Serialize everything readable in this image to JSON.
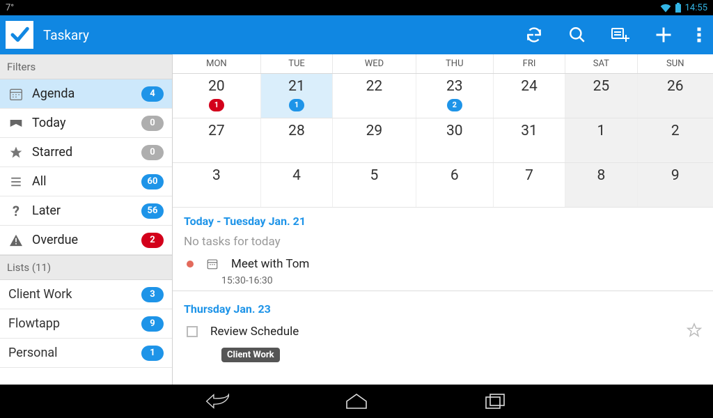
{
  "status": {
    "temp": "7°",
    "time": "14:55"
  },
  "app": {
    "title": "Taskary"
  },
  "sidebar": {
    "filters_header": "Filters",
    "lists_header": "Lists (11)",
    "filters": [
      {
        "label": "Agenda",
        "count": "4",
        "color": "blue",
        "selected": true
      },
      {
        "label": "Today",
        "count": "0",
        "color": "gray"
      },
      {
        "label": "Starred",
        "count": "0",
        "color": "gray"
      },
      {
        "label": "All",
        "count": "60",
        "color": "blue"
      },
      {
        "label": "Later",
        "count": "56",
        "color": "blue"
      },
      {
        "label": "Overdue",
        "count": "2",
        "color": "red"
      }
    ],
    "lists": [
      {
        "label": "Client Work",
        "count": "3"
      },
      {
        "label": "Flowtapp",
        "count": "9"
      },
      {
        "label": "Personal",
        "count": "1"
      }
    ]
  },
  "calendar": {
    "days": [
      "MON",
      "TUE",
      "WED",
      "THU",
      "FRI",
      "SAT",
      "SUN"
    ],
    "rows": [
      [
        {
          "n": "20",
          "badge": "1",
          "badge_color": "red"
        },
        {
          "n": "21",
          "badge": "1",
          "badge_color": "blue",
          "today": true
        },
        {
          "n": "22"
        },
        {
          "n": "23",
          "badge": "2",
          "badge_color": "blue"
        },
        {
          "n": "24"
        },
        {
          "n": "25",
          "weekend": true
        },
        {
          "n": "26",
          "weekend": true
        }
      ],
      [
        {
          "n": "27"
        },
        {
          "n": "28"
        },
        {
          "n": "29"
        },
        {
          "n": "30"
        },
        {
          "n": "31"
        },
        {
          "n": "1",
          "weekend": true
        },
        {
          "n": "2",
          "weekend": true
        }
      ],
      [
        {
          "n": "3"
        },
        {
          "n": "4"
        },
        {
          "n": "5"
        },
        {
          "n": "6"
        },
        {
          "n": "7"
        },
        {
          "n": "8",
          "weekend": true
        },
        {
          "n": "9",
          "weekend": true
        }
      ]
    ]
  },
  "agenda": {
    "sections": [
      {
        "header": "Today - Tuesday Jan. 21",
        "empty_text": "No tasks for today",
        "tasks": [
          {
            "title": "Meet with Tom",
            "time": "15:30-16:30",
            "dot": true
          }
        ]
      },
      {
        "header": "Thursday Jan. 23",
        "tasks": [
          {
            "title": "Review Schedule",
            "tag": "Client Work",
            "checkbox": true,
            "star": true
          }
        ]
      }
    ]
  }
}
